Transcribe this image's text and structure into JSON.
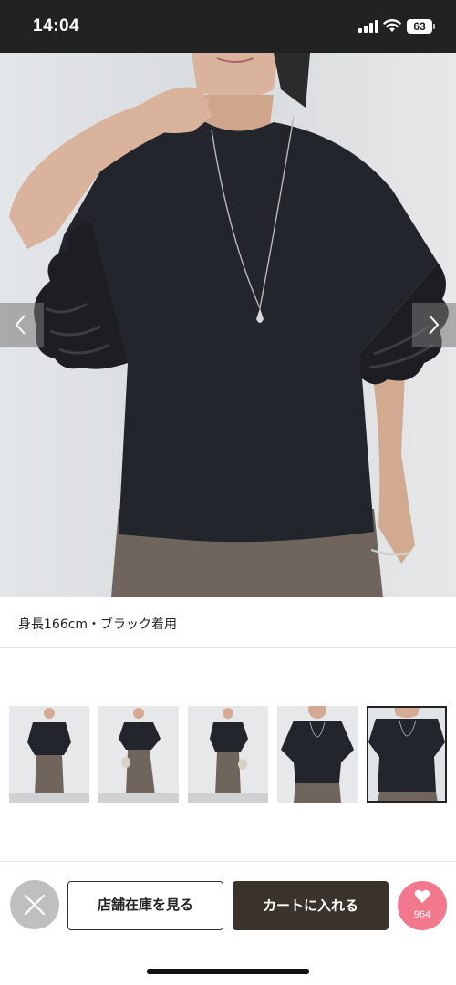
{
  "status_bar": {
    "time": "14:04",
    "battery_level": "63",
    "icons": [
      "signal-icon",
      "wifi-icon",
      "battery-icon"
    ]
  },
  "product_image": {
    "alt": "black ruffle-sleeve t-shirt worn with necklace and khaki skirt",
    "prev_icon": "chevron-left-icon",
    "next_icon": "chevron-right-icon"
  },
  "caption": "身長166cm・ブラック着用",
  "thumbnails": {
    "count": 5,
    "selected_index": 4
  },
  "actions": {
    "close_icon": "close-icon",
    "store_stock_label": "店舗在庫を見る",
    "cart_label": "カートに入れる",
    "favorite_icon": "heart-icon",
    "favorite_count": "964"
  },
  "colors": {
    "status_bar_bg": "#222222",
    "cart_bg": "#3a332c",
    "favorite_bg": "#f2788d",
    "close_bg": "#bfbfbf",
    "shirt": "#22252b",
    "skirt": "#6f655c"
  }
}
